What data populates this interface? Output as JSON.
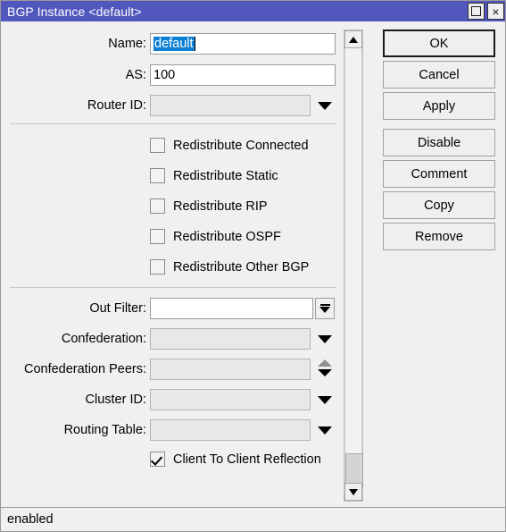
{
  "window": {
    "title": "BGP Instance <default>",
    "controls": [
      {
        "name": "maximize",
        "glyph": "square"
      },
      {
        "name": "close",
        "glyph": "×"
      }
    ]
  },
  "colors": {
    "titlebar": "#5257bd",
    "dialog_bg": "#f0f0f0",
    "selection": "#0b7fd4",
    "field_bg": "#ffffff",
    "field_disabled_bg": "#e8e8e8"
  },
  "form": {
    "fields": [
      {
        "label": "Name:",
        "value": "default",
        "selected": true,
        "type": "text"
      },
      {
        "label": "AS:",
        "value": "100",
        "selected": false,
        "type": "text"
      },
      {
        "label": "Router ID:",
        "value": "",
        "selected": false,
        "type": "combo"
      },
      {
        "label": "Out Filter:",
        "value": "",
        "selected": false,
        "type": "filter"
      },
      {
        "label": "Confederation:",
        "value": "",
        "selected": false,
        "type": "combo"
      },
      {
        "label": "Confederation Peers:",
        "value": "",
        "selected": false,
        "type": "spinner"
      },
      {
        "label": "Cluster ID:",
        "value": "",
        "selected": false,
        "type": "combo"
      },
      {
        "label": "Routing Table:",
        "value": "",
        "selected": false,
        "type": "combo"
      }
    ],
    "checkboxes": [
      {
        "label": "Redistribute Connected",
        "checked": false
      },
      {
        "label": "Redistribute Static",
        "checked": false
      },
      {
        "label": "Redistribute RIP",
        "checked": false
      },
      {
        "label": "Redistribute OSPF",
        "checked": false
      },
      {
        "label": "Redistribute Other BGP",
        "checked": false
      },
      {
        "label": "Client To Client Reflection",
        "checked": true
      }
    ]
  },
  "buttons": [
    {
      "label": "OK",
      "default": true
    },
    {
      "label": "Cancel",
      "default": false
    },
    {
      "label": "Apply",
      "default": false
    },
    {
      "label": "Disable",
      "default": false
    },
    {
      "label": "Comment",
      "default": false
    },
    {
      "label": "Copy",
      "default": false
    },
    {
      "label": "Remove",
      "default": false
    }
  ],
  "scrollbar": {
    "up_icon": "scroll-up-arrow-icon",
    "down_icon": "scroll-down-arrow-icon"
  },
  "statusbar": {
    "text": "enabled"
  }
}
